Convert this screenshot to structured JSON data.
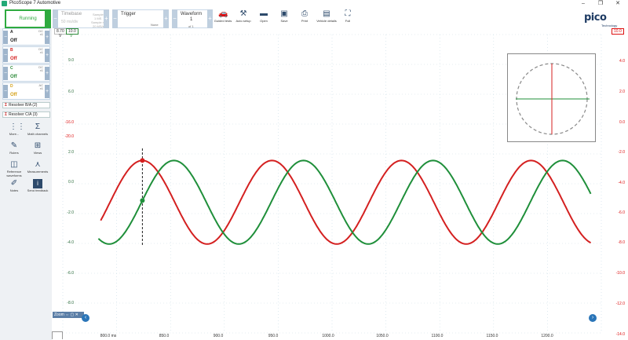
{
  "window": {
    "title": "PicoScope 7 Automotive",
    "min": "–",
    "max": "❐",
    "close": "✕"
  },
  "toolbar": {
    "run_label": "Running",
    "timebase": {
      "label": "Timebase",
      "value": "50 ms/div",
      "samples_label": "Samples",
      "samples_value": "1 MS",
      "sample_rate": "Sample rate",
      "rate_value": "20 MS/s"
    },
    "trigger": {
      "label": "Trigger",
      "value": "None"
    },
    "waveform": {
      "label": "Waveform",
      "value": "1",
      "of": "of 1"
    },
    "buttons": [
      {
        "label": "Guided tests",
        "icon": "car-icon"
      },
      {
        "label": "Auto setup",
        "icon": "wand-icon"
      },
      {
        "label": "Open",
        "icon": "folder-icon"
      },
      {
        "label": "Save",
        "icon": "save-icon"
      },
      {
        "label": "Print",
        "icon": "print-icon"
      },
      {
        "label": "Vehicle details",
        "icon": "document-icon"
      },
      {
        "label": "Full",
        "icon": "fullscreen-icon"
      }
    ],
    "logo": "pico",
    "logo_sub": "Technology"
  },
  "channels": [
    {
      "name": "A",
      "state": "Off",
      "coupling": "DC",
      "probe": "x1",
      "color": "#222222"
    },
    {
      "name": "B",
      "state": "Off",
      "coupling": "DC",
      "probe": "x1",
      "color": "#d42020"
    },
    {
      "name": "C",
      "state": "Off",
      "coupling": "DC",
      "probe": "x1",
      "color": "#2e8b3a"
    },
    {
      "name": "D",
      "state": "Off",
      "coupling": "AC",
      "probe": "x1",
      "color": "#d4a017"
    }
  ],
  "resolvers": [
    "Resolver B/A (2)",
    "Resolver C/A (3)"
  ],
  "side_tools": [
    {
      "label": "More...",
      "icon": "grid-icon"
    },
    {
      "label": "Math channels",
      "icon": "sigma-icon"
    },
    {
      "label": "Rulers",
      "icon": "ruler-icon"
    },
    {
      "label": "Views",
      "icon": "views-icon"
    },
    {
      "label": "Reference waveforms",
      "icon": "reference-icon"
    },
    {
      "label": "Measurements",
      "icon": "measure-icon"
    },
    {
      "label": "Notes",
      "icon": "notes-icon"
    },
    {
      "label": "Send feedback",
      "icon": "feedback-icon"
    }
  ],
  "scope": {
    "top_chips": {
      "left_a": "8.70",
      "left_b": "10.0",
      "right": "10.0"
    },
    "left_axis_unit": "V",
    "left_axis_labels": [
      "9.0",
      "6.0",
      "-16.0",
      "-20.0",
      "2.0",
      "0.0",
      "-2.0",
      "-4.0",
      "-6.0",
      "-8.0"
    ],
    "right_axis_labels": [
      "4.0",
      "2.0",
      "0.0",
      "-2.0",
      "-4.0",
      "-6.0",
      "-8.0",
      "-10.0",
      "-12.0",
      "-14.0"
    ],
    "x_labels": [
      "800.0 ms",
      "850.0",
      "900.0",
      "950.0",
      "1000.0",
      "1050.0",
      "1100.0",
      "1150.0",
      "1200.0"
    ],
    "zoom_label": "Zoom",
    "colors": {
      "red": "#d42020",
      "green": "#1f8f3a",
      "grid": "#c9dce6"
    }
  },
  "chart_data": {
    "type": "line",
    "x_unit": "ms",
    "xlim": [
      780,
      1240
    ],
    "ylim": [
      -9,
      9
    ],
    "series": [
      {
        "color": "#d42020",
        "amplitude": 2.8,
        "offset": -1.4,
        "period": 115,
        "phase_peak_at": 840
      },
      {
        "color": "#1f8f3a",
        "amplitude": 2.8,
        "offset": -1.4,
        "period": 115,
        "phase_peak_at": 868
      }
    ]
  }
}
